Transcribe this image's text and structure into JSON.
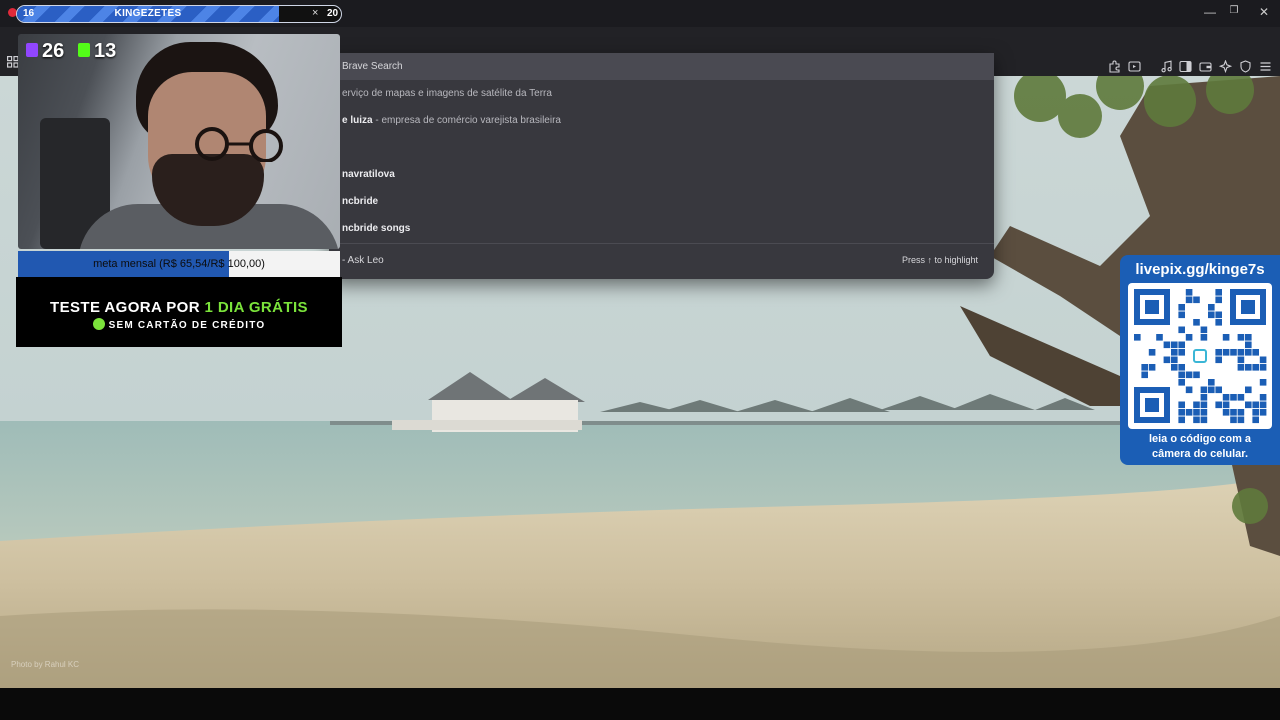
{
  "tab": {
    "count_left": "16",
    "title": "KINGEZETES",
    "close_glyph": "×",
    "count_right": "20"
  },
  "window_controls": {
    "minimize": "—",
    "restore": "❐",
    "close": "✕"
  },
  "toolbar_icons": [
    "extensions-icon",
    "media-icon",
    "music-icon",
    "sidebar-icon",
    "wallet-icon",
    "leo-ai-icon",
    "shield-icon",
    "menu-icon"
  ],
  "omnibox": {
    "top_row": "Brave Search",
    "suggestions": [
      {
        "bold": "",
        "text": "erviço de mapas e imagens de satélite da Terra"
      },
      {
        "bold": "e luiza",
        "text": " - empresa de comércio varejista brasileira"
      },
      {
        "bold": "",
        "text": ""
      },
      {
        "bold": "navratilova",
        "text": ""
      },
      {
        "bold": "ncbride",
        "text": ""
      },
      {
        "bold": "ncbride songs",
        "text": ""
      }
    ],
    "ask_leo": "- Ask Leo",
    "hint": "Press ↑ to highlight"
  },
  "stream": {
    "twitch_count": "26",
    "kick_count": "13",
    "goal_text_left": "meta mensal (R$ 65,54/R$",
    "goal_text_right": " 100,00)",
    "goal_progress": 0.6554,
    "promo_line1_a": "TESTE AGORA POR ",
    "promo_line1_b": "1 DIA GRÁTIS",
    "promo_line2": "SEM CARTÃO DE CRÉDITO",
    "colors": {
      "goal_fill": "#2158b1",
      "promo_accent": "#7be33b",
      "twitch": "#9146ff",
      "kick": "#53fc18"
    }
  },
  "qr": {
    "url": "livepix.gg/kinge7s",
    "caption1": "leia o código com a",
    "caption2": "câmera do celular."
  },
  "photo_credit": "Photo by Rahul KC"
}
